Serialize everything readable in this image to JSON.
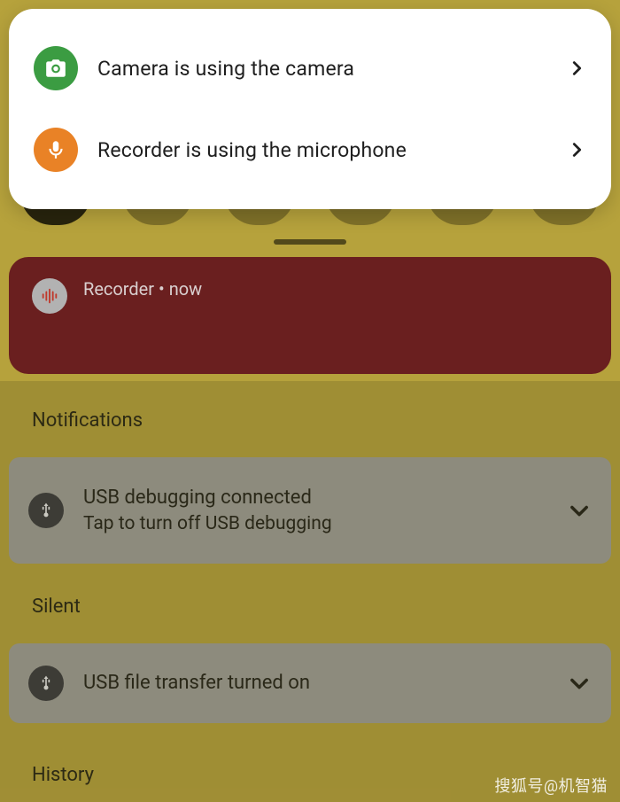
{
  "privacy": {
    "items": [
      {
        "icon": "camera-icon",
        "icon_color": "green",
        "label": "Camera is using the camera"
      },
      {
        "icon": "microphone-icon",
        "icon_color": "orange",
        "label": "Recorder is using the microphone"
      }
    ]
  },
  "heads_up": {
    "app": "Recorder",
    "sep": " • ",
    "time": "now",
    "icon": "sound-wave-icon"
  },
  "sections": {
    "notifications": "Notifications",
    "silent": "Silent",
    "history": "History"
  },
  "notifications": {
    "usb_debug": {
      "title": "USB debugging connected",
      "subtitle": "Tap to turn off USB debugging",
      "icon": "usb-icon"
    },
    "usb_file": {
      "title": "USB file transfer turned on",
      "icon": "usb-icon"
    }
  },
  "watermark": "搜狐号@机智猫",
  "colors": {
    "bg": "#b6a23c",
    "priv_green": "#3b9c42",
    "priv_orange": "#e98226",
    "rec_card": "#6a1f1f",
    "grey_card": "#8d8b7d"
  }
}
